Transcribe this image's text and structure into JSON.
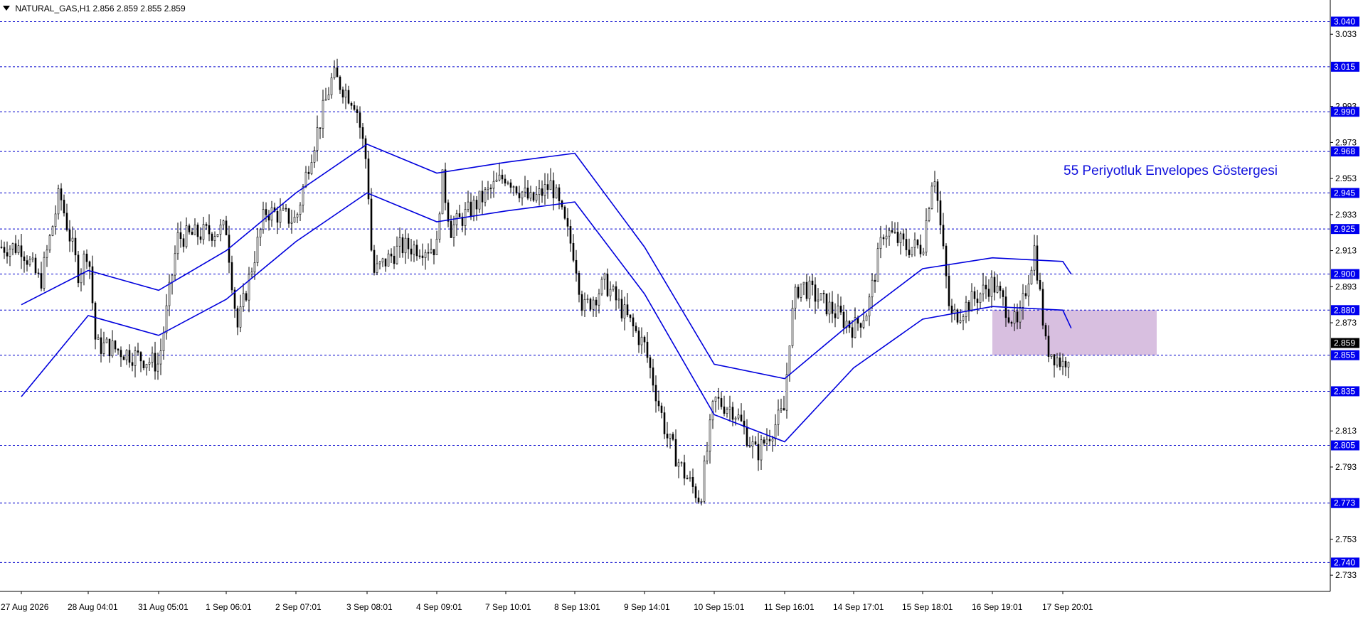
{
  "header": {
    "symbol": "NATURAL_GAS,H1",
    "ohlc": "2.856 2.859 2.855 2.859"
  },
  "annotation": "55 Periyotluk Envelopes Göstergesi",
  "colors": {
    "level_line": "#0000cc",
    "envelope": "#0000dd",
    "candle": "#000000",
    "zone": "#d8bfe0",
    "level_label_bg": "#0000ee",
    "current_label_bg": "#000000"
  },
  "chart_data": {
    "type": "candlestick",
    "ylim": [
      2.724,
      3.052
    ],
    "x_ticks": [
      "27 Aug 2026",
      "28 Aug 04:01",
      "31 Aug 05:01",
      "1 Sep 06:01",
      "2 Sep 07:01",
      "3 Sep 08:01",
      "4 Sep 09:01",
      "7 Sep 10:01",
      "8 Sep 13:01",
      "9 Sep 14:01",
      "10 Sep 15:01",
      "11 Sep 16:01",
      "14 Sep 17:01",
      "15 Sep 18:01",
      "16 Sep 19:01",
      "17 Sep 20:01"
    ],
    "y_ticks": [
      "3.033",
      "2.993",
      "2.973",
      "2.953",
      "2.933",
      "2.913",
      "2.893",
      "2.873",
      "2.813",
      "2.793",
      "2.753",
      "2.733"
    ],
    "levels": [
      3.04,
      3.015,
      2.99,
      2.968,
      2.945,
      2.925,
      2.9,
      2.88,
      2.855,
      2.835,
      2.805,
      2.773,
      2.74
    ],
    "level_labels": [
      "3.040",
      "3.015",
      "2.990",
      "2.968",
      "2.945",
      "2.925",
      "2.900",
      "2.880",
      "2.855",
      "2.835",
      "2.805",
      "2.773",
      "2.740"
    ],
    "current_price": 2.859,
    "current_price_label": "2.859",
    "zone": {
      "start": "16 Sep 19:01",
      "end": "17 Sep 20:01",
      "low": 2.855,
      "high": 2.88
    },
    "close_path": [
      [
        "27 Aug 2026",
        2.915
      ],
      [
        "27 Aug 08:00",
        2.895
      ],
      [
        "27 Aug 16:00",
        2.945
      ],
      [
        "28 Aug 00:00",
        2.9
      ],
      [
        "28 Aug 04:01",
        2.915
      ],
      [
        "28 Aug 12:00",
        2.86
      ],
      [
        "29 Aug 00:00",
        2.86
      ],
      [
        "31 Aug 05:01",
        2.85
      ],
      [
        "31 Aug 12:00",
        2.92
      ],
      [
        "1 Sep 06:01",
        2.925
      ],
      [
        "1 Sep 10:00",
        2.87
      ],
      [
        "1 Sep 20:00",
        2.935
      ],
      [
        "2 Sep 07:01",
        2.93
      ],
      [
        "2 Sep 12:00",
        2.965
      ],
      [
        "2 Sep 20:00",
        3.01
      ],
      [
        "3 Sep 04:00",
        2.995
      ],
      [
        "3 Sep 08:01",
        2.96
      ],
      [
        "3 Sep 10:00",
        2.9
      ],
      [
        "3 Sep 20:00",
        2.915
      ],
      [
        "4 Sep 09:01",
        2.915
      ],
      [
        "4 Sep 14:00",
        2.955
      ],
      [
        "5 Sep 00:00",
        2.925
      ],
      [
        "7 Sep 10:01",
        2.955
      ],
      [
        "7 Sep 20:00",
        2.94
      ],
      [
        "8 Sep 04:00",
        2.95
      ],
      [
        "8 Sep 13:01",
        2.91
      ],
      [
        "8 Sep 16:00",
        2.88
      ],
      [
        "9 Sep 00:00",
        2.895
      ],
      [
        "9 Sep 14:01",
        2.86
      ],
      [
        "9 Sep 22:00",
        2.81
      ],
      [
        "10 Sep 04:00",
        2.79
      ],
      [
        "10 Sep 10:00",
        2.775
      ],
      [
        "10 Sep 15:01",
        2.83
      ],
      [
        "10 Sep 22:00",
        2.825
      ],
      [
        "11 Sep 06:00",
        2.8
      ],
      [
        "11 Sep 16:01",
        2.825
      ],
      [
        "11 Sep 20:00",
        2.86
      ],
      [
        "12 Sep 02:00",
        2.885
      ],
      [
        "12 Sep 08:00",
        2.895
      ],
      [
        "14 Sep 17:01",
        2.87
      ],
      [
        "14 Sep 22:00",
        2.88
      ],
      [
        "15 Sep 04:00",
        2.925
      ],
      [
        "15 Sep 12:00",
        2.915
      ],
      [
        "15 Sep 18:01",
        2.915
      ],
      [
        "15 Sep 22:00",
        2.96
      ],
      [
        "16 Sep 04:00",
        2.875
      ],
      [
        "16 Sep 19:01",
        2.895
      ],
      [
        "17 Sep 04:00",
        2.87
      ],
      [
        "17 Sep 10:00",
        2.915
      ],
      [
        "17 Sep 14:00",
        2.86
      ],
      [
        "17 Sep 20:01",
        2.85
      ],
      [
        "17 Sep 23:00",
        2.859
      ]
    ],
    "envelope_upper": [
      [
        "27 Aug 2026",
        2.883
      ],
      [
        "28 Aug 04:01",
        2.902
      ],
      [
        "31 Aug 05:01",
        2.891
      ],
      [
        "1 Sep 06:01",
        2.913
      ],
      [
        "2 Sep 07:01",
        2.945
      ],
      [
        "3 Sep 08:01",
        2.972
      ],
      [
        "4 Sep 09:01",
        2.956
      ],
      [
        "7 Sep 10:01",
        2.962
      ],
      [
        "8 Sep 13:01",
        2.967
      ],
      [
        "9 Sep 14:01",
        2.915
      ],
      [
        "10 Sep 15:01",
        2.85
      ],
      [
        "11 Sep 16:01",
        2.842
      ],
      [
        "14 Sep 17:01",
        2.874
      ],
      [
        "15 Sep 18:01",
        2.903
      ],
      [
        "16 Sep 19:01",
        2.909
      ],
      [
        "17 Sep 20:01",
        2.907
      ],
      [
        "17 Sep 23:00",
        2.9
      ]
    ],
    "envelope_lower": [
      [
        "27 Aug 2026",
        2.832
      ],
      [
        "28 Aug 04:01",
        2.877
      ],
      [
        "31 Aug 05:01",
        2.866
      ],
      [
        "1 Sep 06:01",
        2.886
      ],
      [
        "2 Sep 07:01",
        2.918
      ],
      [
        "3 Sep 08:01",
        2.945
      ],
      [
        "4 Sep 09:01",
        2.929
      ],
      [
        "7 Sep 10:01",
        2.935
      ],
      [
        "8 Sep 13:01",
        2.94
      ],
      [
        "9 Sep 14:01",
        2.889
      ],
      [
        "10 Sep 15:01",
        2.822
      ],
      [
        "11 Sep 16:01",
        2.807
      ],
      [
        "14 Sep 17:01",
        2.848
      ],
      [
        "15 Sep 18:01",
        2.875
      ],
      [
        "16 Sep 19:01",
        2.882
      ],
      [
        "17 Sep 20:01",
        2.88
      ],
      [
        "17 Sep 23:00",
        2.87
      ]
    ]
  }
}
